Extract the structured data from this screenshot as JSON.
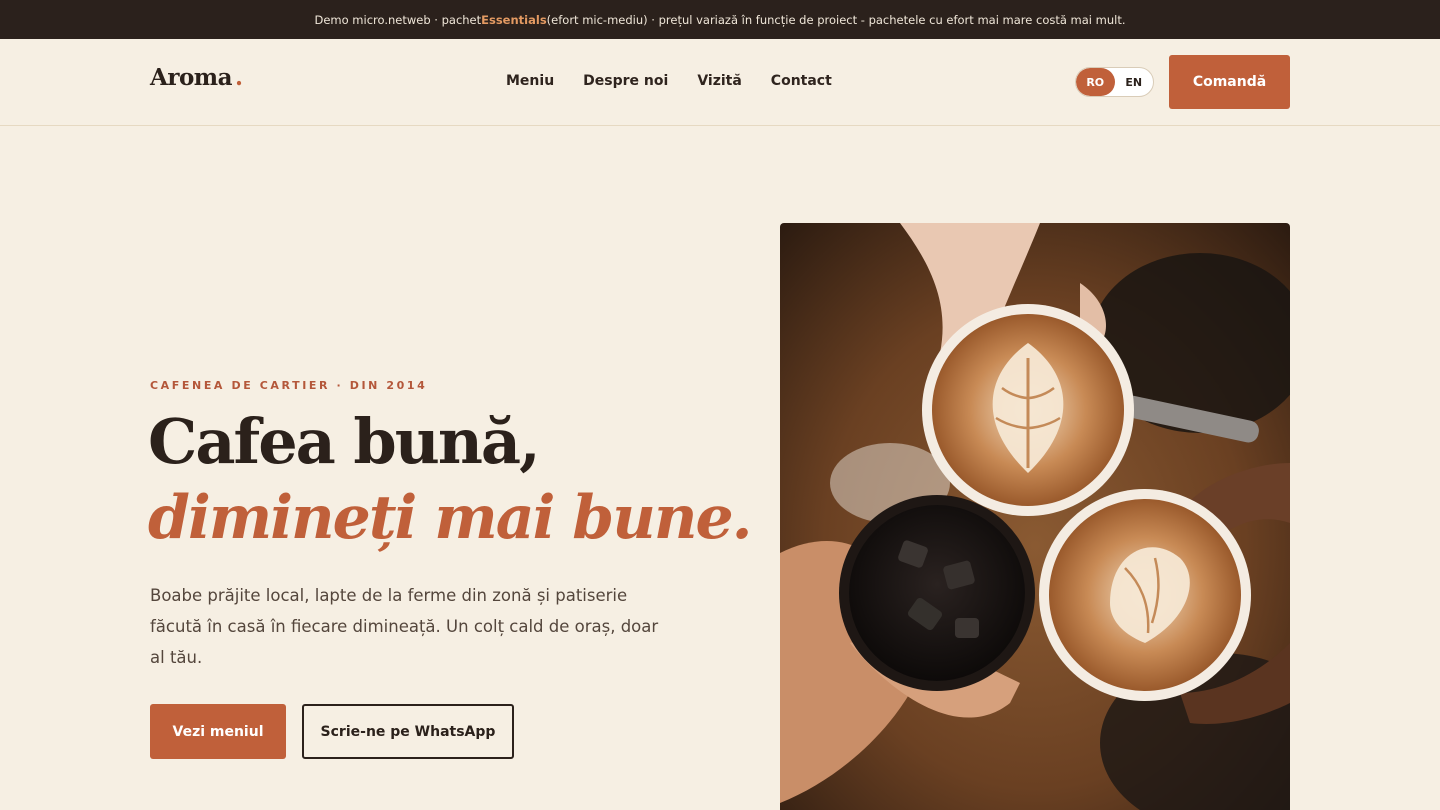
{
  "promo": {
    "prefix": "Demo micro.netweb · pachet ",
    "highlight": "Essentials",
    "suffix": " (efort mic-mediu) · prețul variază în funcție de proiect - pachetele cu efort mai mare costă mai mult."
  },
  "header": {
    "logo": "Aroma",
    "logo_dot": ".",
    "nav": [
      "Meniu",
      "Despre noi",
      "Vizită",
      "Contact"
    ],
    "lang": {
      "active": "RO",
      "inactive": "EN"
    },
    "order_label": "Comandă"
  },
  "hero": {
    "eyebrow": "CAFENEA DE CARTIER · DIN 2014",
    "title_line1": "Cafea bună,",
    "title_line2": "dimineți mai bune.",
    "lead": "Boabe prăjite local, lapte de la ferme din zonă și patiserie făcută în casă în fiecare dimineață. Un colț cald de oraș, doar al tău.",
    "cta_primary": "Vezi meniul",
    "cta_secondary": "Scrie-ne pe WhatsApp"
  },
  "colors": {
    "accent": "#c0603a",
    "dark": "#2b211b",
    "background": "#f6efe3",
    "promo_bg": "#2b211c"
  },
  "icons": {
    "hero_image": "coffee-cups-toast-photo"
  }
}
